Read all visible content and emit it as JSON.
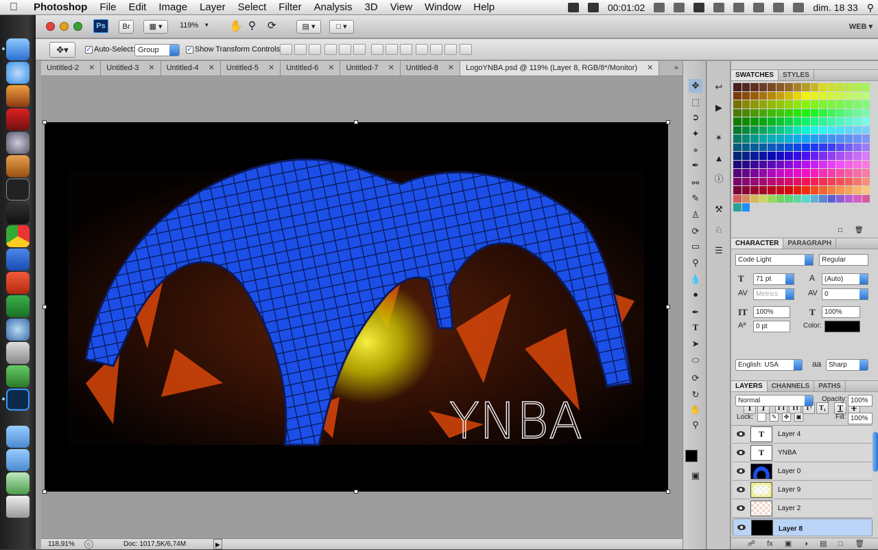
{
  "menubar": {
    "app_name": "Photoshop",
    "menus": [
      "File",
      "Edit",
      "Image",
      "Layer",
      "Select",
      "Filter",
      "Analysis",
      "3D",
      "View",
      "Window",
      "Help"
    ],
    "clock": "00:01:02",
    "datetime": "dim. 18 33"
  },
  "appbar": {
    "ps_label": "Ps",
    "br_label": "Br",
    "zoom": "119%",
    "workspace": "WEB"
  },
  "options": {
    "auto_select_label": "Auto-Select:",
    "auto_select_checked": true,
    "auto_select_value": "Group",
    "show_transform_label": "Show Transform Controls",
    "show_transform_checked": true
  },
  "tabs": [
    {
      "label": "Untitled-2"
    },
    {
      "label": "Untitled-3"
    },
    {
      "label": "Untitled-4"
    },
    {
      "label": "Untitled-5"
    },
    {
      "label": "Untitled-6"
    },
    {
      "label": "Untitled-7"
    },
    {
      "label": "Untitled-8"
    },
    {
      "label": "LogoYNBA.psd @ 119% (Layer 8, RGB/8*/Monitor)"
    }
  ],
  "canvas": {
    "artwork_text": "YNBA",
    "accent_blue": "#1b4fe8",
    "accent_orange": "#d8460a",
    "accent_yellow": "#e8e000"
  },
  "statusbar": {
    "zoom": "118,91%",
    "doc_info": "Doc: 1017,5K/6,74M"
  },
  "swatches": {
    "tab_swatches": "SWATCHES",
    "tab_styles": "STYLES"
  },
  "character": {
    "tab_character": "CHARACTER",
    "tab_paragraph": "PARAGRAPH",
    "font_family": "Code Light",
    "font_style": "Regular",
    "font_size": "71 pt",
    "leading": "(Auto)",
    "kerning": "Metrics",
    "tracking": "0",
    "vertical_scale": "100%",
    "horizontal_scale": "100%",
    "baseline_shift": "0 pt",
    "color_label": "Color:",
    "language": "English: USA",
    "antialias_label": "aa",
    "antialias": "Sharp",
    "text_color": "#000000"
  },
  "layers": {
    "tab_layers": "LAYERS",
    "tab_channels": "CHANNELS",
    "tab_paths": "PATHS",
    "blend_mode": "Normal",
    "opacity_label": "Opacity:",
    "opacity": "100%",
    "lock_label": "Lock:",
    "fill_label": "Fill:",
    "fill": "100%",
    "items": [
      {
        "name": "Layer 4",
        "type": "text",
        "selected": false
      },
      {
        "name": "YNBA",
        "type": "text",
        "selected": false
      },
      {
        "name": "Layer 0",
        "type": "image",
        "selected": false
      },
      {
        "name": "Layer 9",
        "type": "image",
        "selected": false
      },
      {
        "name": "Layer 2",
        "type": "image",
        "selected": false
      },
      {
        "name": "Layer 8",
        "type": "image",
        "selected": true
      }
    ]
  }
}
